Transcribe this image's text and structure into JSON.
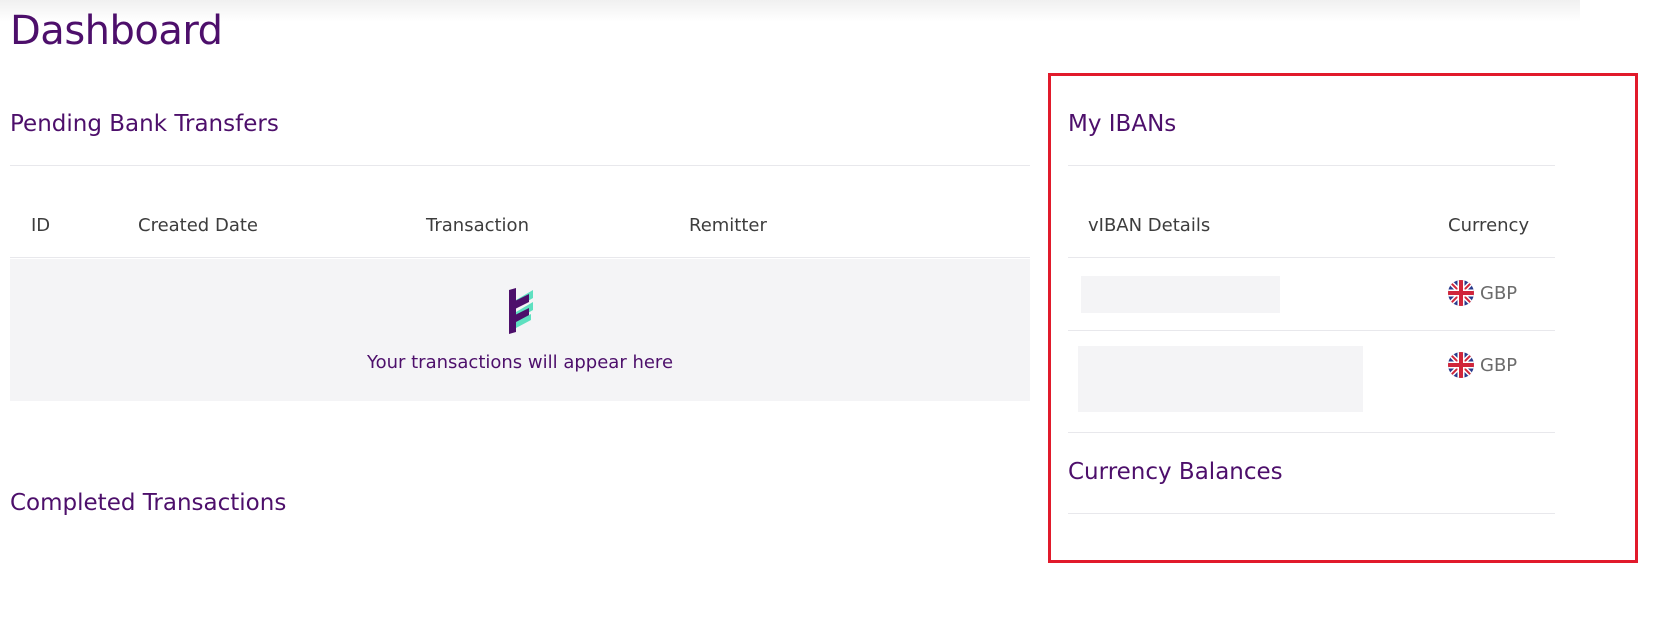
{
  "page": {
    "title": "Dashboard"
  },
  "pending_transfers": {
    "title": "Pending Bank Transfers",
    "columns": [
      "ID",
      "Created Date",
      "Transaction",
      "Remitter"
    ],
    "empty_message": "Your transactions will appear here"
  },
  "completed": {
    "title": "Completed Transactions"
  },
  "ibans": {
    "title": "My IBANs",
    "columns": [
      "vIBAN Details",
      "Currency"
    ],
    "rows": [
      {
        "currency": "GBP"
      },
      {
        "currency": "GBP"
      }
    ]
  },
  "balances": {
    "title": "Currency Balances"
  },
  "icons": {
    "empty_state": "striped-logo-icon",
    "currency_flag": "uk-flag-icon"
  },
  "colors": {
    "heading": "#4d0f6b",
    "highlight_border": "#e11a2b",
    "panel_bg": "#f4f4f6",
    "accent_green": "#5ee0c0"
  }
}
